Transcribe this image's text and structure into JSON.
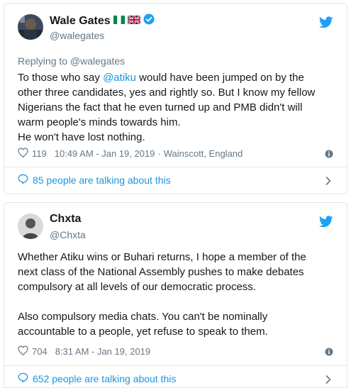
{
  "tweets": [
    {
      "display_name": "Wale Gates",
      "handle": "@walegates",
      "replying_to": "Replying to @walegates",
      "text_lines": [
        [
          "To those who say ",
          "@atiku",
          " would have been jumped on by the"
        ],
        [
          "other three candidates, yes and rightly so. But I know my fellow"
        ],
        [
          "Nigerians the fact that he even turned up and PMB didn't will"
        ],
        [
          "warm people's minds towards him."
        ],
        [
          "He won't have lost nothing."
        ]
      ],
      "likes": "119",
      "timestamp": "10:49 AM - Jan 19, 2019",
      "location": "Wainscott, England",
      "talking": "85 people are talking about this"
    },
    {
      "display_name": "Chxta",
      "handle": "@Chxta",
      "text_lines": [
        [
          "Whether Atiku wins or Buhari returns, I hope a member of the"
        ],
        [
          "next class of the National Assembly pushes to make debates"
        ],
        [
          "compulsory at all levels of our democratic process."
        ],
        [],
        [
          "Also compulsory media chats. You can't be nominally"
        ],
        [
          "accountable to a people, yet refuse to speak to them."
        ]
      ],
      "likes": "704",
      "timestamp": "8:31 AM - Jan 19, 2019",
      "talking": "652 people are talking about this"
    }
  ],
  "icons": {
    "twitter_bird": "twitter-bird-icon",
    "verified": "verified-badge-icon",
    "heart": "heart-icon",
    "info": "info-icon",
    "comment": "comment-bubble-icon",
    "chevron": "chevron-right-icon"
  },
  "colors": {
    "twitter_blue": "#1da1f2",
    "link_blue": "#1b95e0",
    "secondary_text": "#657786",
    "border": "#e1e8ed"
  }
}
